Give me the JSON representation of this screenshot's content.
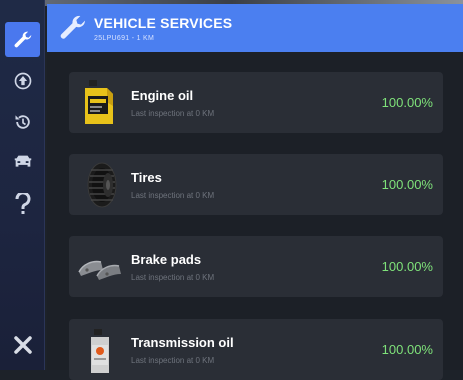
{
  "header": {
    "title": "VEHICLE SERVICES",
    "subtitle": "25LPU691 - 1 KM"
  },
  "sidebar": {
    "items": [
      {
        "icon": "wrench-icon",
        "active": true
      },
      {
        "icon": "upgrade-arrow-icon",
        "active": false
      },
      {
        "icon": "history-icon",
        "active": false
      },
      {
        "icon": "car-icon",
        "active": false
      },
      {
        "icon": "help-icon",
        "active": false
      }
    ],
    "close_icon": "close-icon"
  },
  "services": [
    {
      "name": "Engine oil",
      "inspection": "Last inspection at 0 KM",
      "percent": "100.00%",
      "icon": "engine-oil-bottle-icon"
    },
    {
      "name": "Tires",
      "inspection": "Last inspection at 0 KM",
      "percent": "100.00%",
      "icon": "tire-icon"
    },
    {
      "name": "Brake pads",
      "inspection": "Last inspection at 0 KM",
      "percent": "100.00%",
      "icon": "brake-pads-icon"
    },
    {
      "name": "Transmission oil",
      "inspection": "Last inspection at 0 KM",
      "percent": "100.00%",
      "icon": "transmission-oil-bottle-icon"
    }
  ],
  "colors": {
    "accent": "#4b7ff0",
    "good": "#7fe27a",
    "card": "#2a2e36",
    "sidebar": "#1f2a46"
  }
}
